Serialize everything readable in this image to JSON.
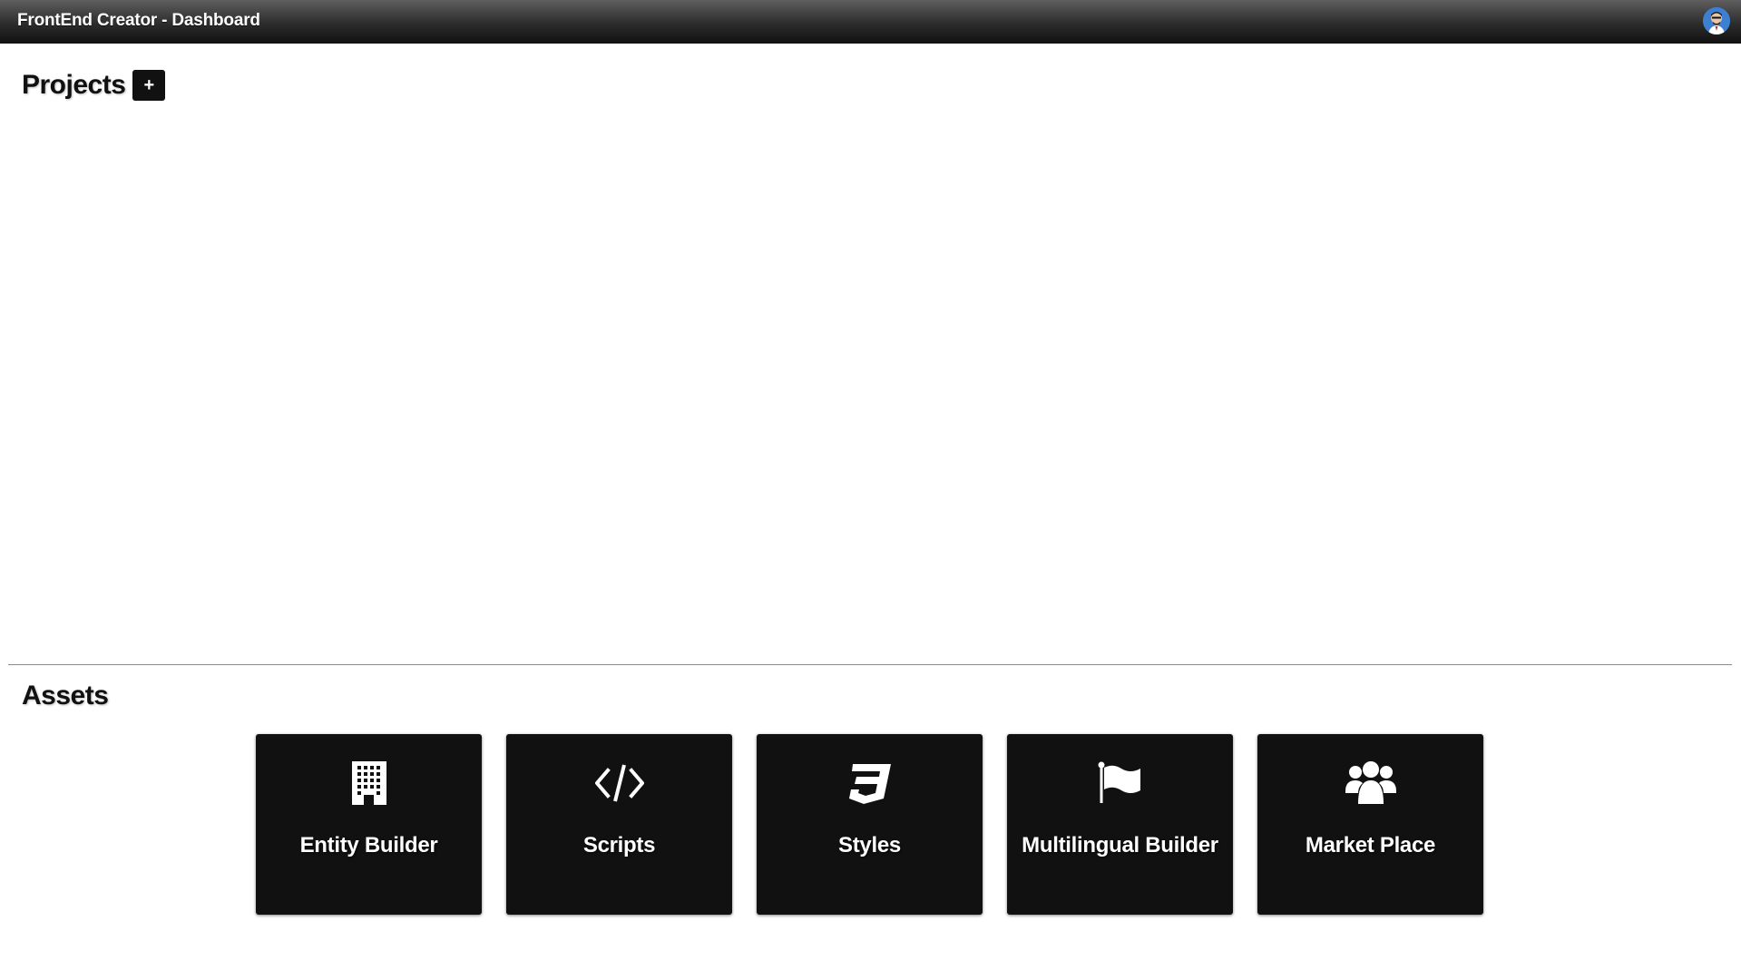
{
  "app": {
    "title": "FrontEnd Creator - Dashboard"
  },
  "user": {
    "avatar_icon": "user-avatar"
  },
  "projects": {
    "heading": "Projects",
    "add_label": "+",
    "add_icon": "plus-icon"
  },
  "assets": {
    "heading": "Assets",
    "cards": [
      {
        "label": "Entity Builder",
        "icon": "building-icon"
      },
      {
        "label": "Scripts",
        "icon": "code-icon"
      },
      {
        "label": "Styles",
        "icon": "css3-icon"
      },
      {
        "label": "Multilingual Builder",
        "icon": "flag-icon"
      },
      {
        "label": "Market Place",
        "icon": "users-icon"
      }
    ]
  },
  "colors": {
    "card_background": "#111111",
    "topbar_dark": "#111111",
    "topbar_light": "#5e5e5e",
    "avatar_background": "#3d7fd0",
    "divider": "#8a8a8a"
  }
}
